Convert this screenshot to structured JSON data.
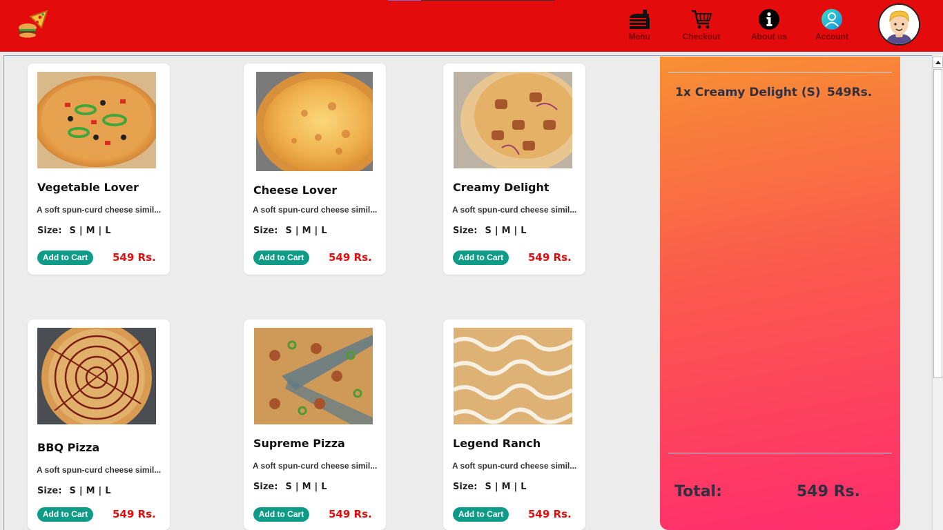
{
  "header": {
    "nav": [
      {
        "label": "Menu",
        "icon": "burger-icon"
      },
      {
        "label": "Checkout",
        "icon": "cart-icon"
      },
      {
        "label": "About us",
        "icon": "info-icon"
      },
      {
        "label": "Account",
        "icon": "user-icon"
      }
    ],
    "colors": {
      "bar": "#e30b0b",
      "nav_label": "#7a0000"
    }
  },
  "menu": {
    "items": [
      {
        "name": "Vegetable Lover",
        "description": "A soft spun-curd cheese simil...",
        "size_label": "Size:",
        "sizes": [
          "S",
          "M",
          "L"
        ],
        "button": "Add to Cart",
        "price": "549 Rs."
      },
      {
        "name": "Cheese Lover",
        "description": "A soft spun-curd cheese simil...",
        "size_label": "Size:",
        "sizes": [
          "S",
          "M",
          "L"
        ],
        "button": "Add to Cart",
        "price": "549 Rs."
      },
      {
        "name": "Creamy Delight",
        "description": "A soft spun-curd cheese simil...",
        "size_label": "Size:",
        "sizes": [
          "S",
          "M",
          "L"
        ],
        "button": "Add to Cart",
        "price": "549 Rs."
      },
      {
        "name": "BBQ Pizza",
        "description": "A soft spun-curd cheese simil...",
        "size_label": "Size:",
        "sizes": [
          "S",
          "M",
          "L"
        ],
        "button": "Add to Cart",
        "price": "549 Rs."
      },
      {
        "name": "Supreme Pizza",
        "description": "A soft spun-curd cheese simil...",
        "size_label": "Size:",
        "sizes": [
          "S",
          "M",
          "L"
        ],
        "button": "Add to Cart",
        "price": "549 Rs."
      },
      {
        "name": "Legend Ranch",
        "description": "A soft spun-curd cheese simil...",
        "size_label": "Size:",
        "sizes": [
          "S",
          "M",
          "L"
        ],
        "button": "Add to Cart",
        "price": "549 Rs."
      }
    ],
    "colors": {
      "button": "#0e9c88",
      "price": "#e30b0b"
    }
  },
  "cart": {
    "line_item": {
      "text": "1x Creamy Delight (S)",
      "price": "549Rs."
    },
    "total_label": "Total:",
    "total_value": "549 Rs."
  }
}
